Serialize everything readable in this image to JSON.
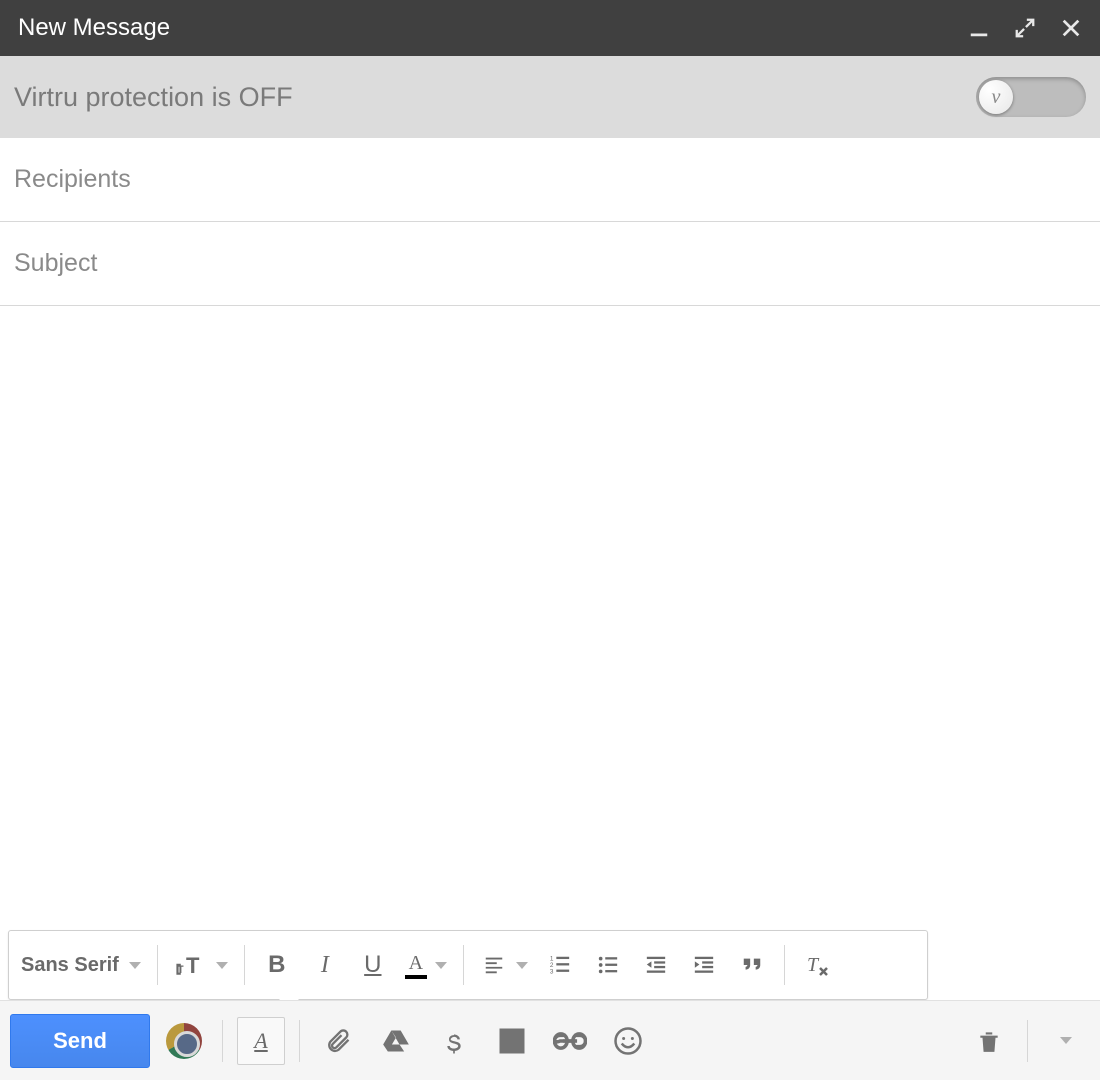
{
  "header": {
    "title": "New Message"
  },
  "virtru": {
    "status_text": "Virtru protection is OFF",
    "knob_glyph": "v"
  },
  "fields": {
    "recipients_placeholder": "Recipients",
    "subject_placeholder": "Subject"
  },
  "format_toolbar": {
    "font_label": "Sans Serif",
    "bold_glyph": "B",
    "italic_glyph": "I",
    "underline_glyph": "U",
    "textcolor_glyph": "A"
  },
  "bottom_bar": {
    "send_label": "Send",
    "format_toggle_glyph": "A"
  }
}
